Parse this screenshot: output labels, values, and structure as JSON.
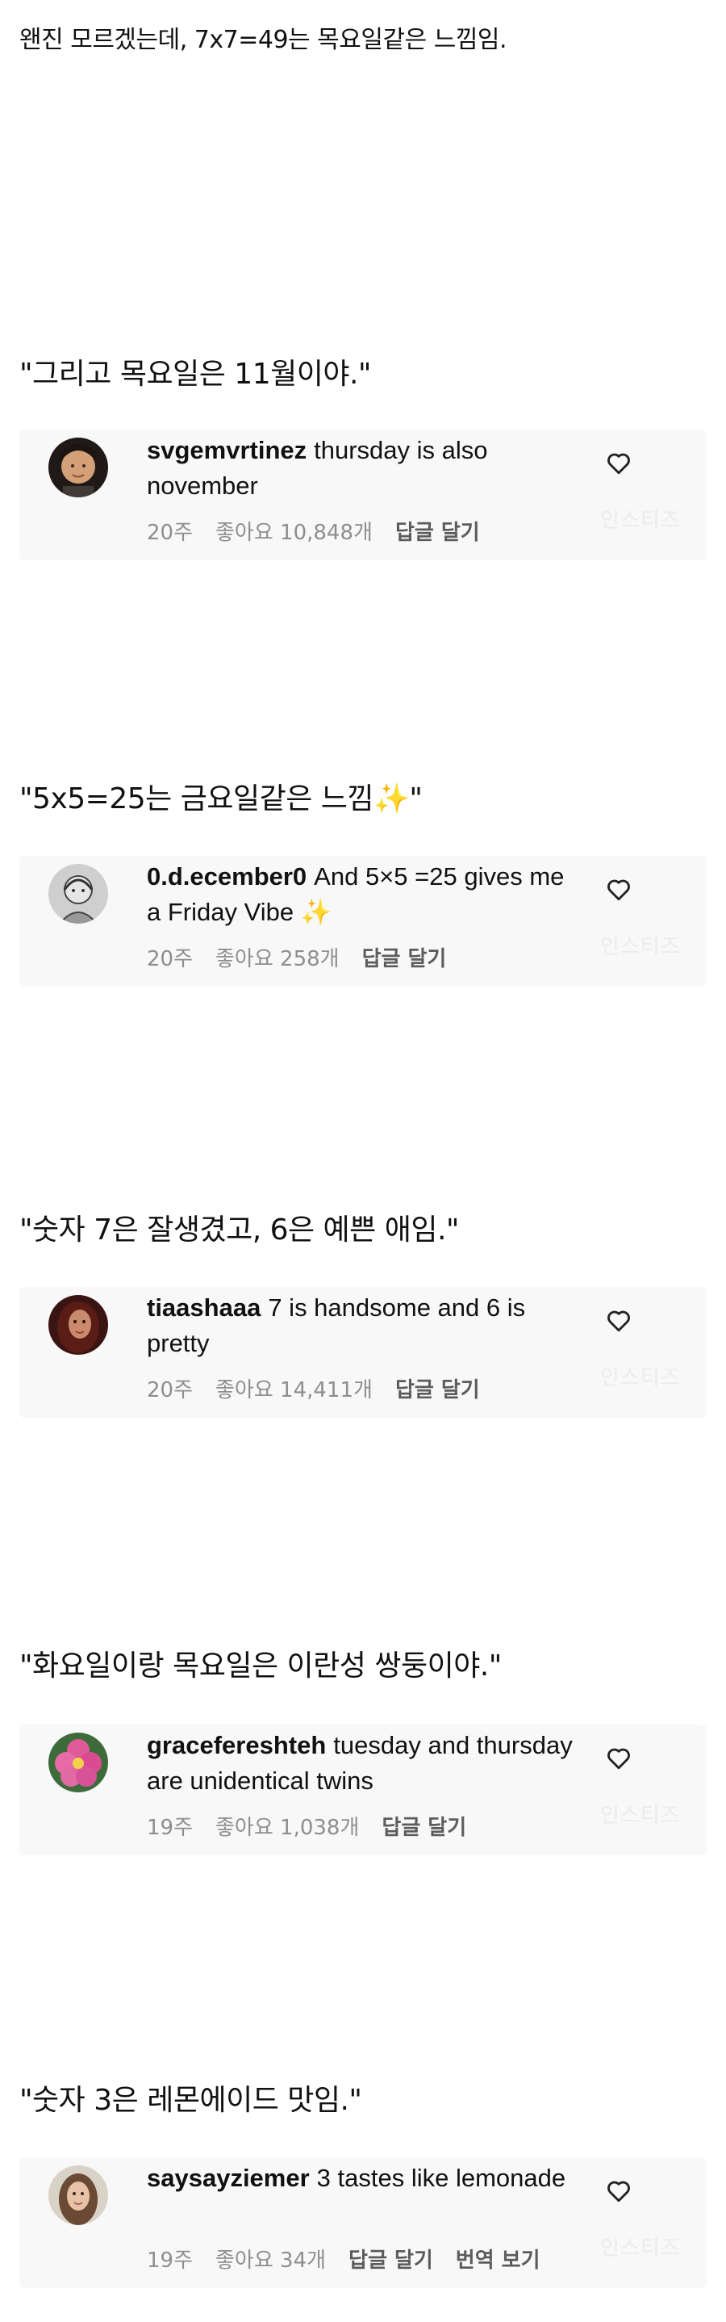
{
  "intro": "왠진 모르겠는데, 7x7=49는 목요일같은 느낌임.",
  "sections": [
    {
      "quote": "\"그리고 목요일은 11월이야.\"",
      "comment": {
        "username": "svgemvrtinez",
        "text": "thursday is also november",
        "age": "20주",
        "likes": "좋아요 10,848개",
        "reply": "답글 달기",
        "watermark": "인스티즈",
        "avatar": "avatar-woman-icon"
      }
    },
    {
      "quote": "\"5x5=25는 금요일같은 느낌✨\"",
      "comment": {
        "username": "0.d.ecember0",
        "text": "And 5×5 =25 gives me a Friday Vibe ✨",
        "age": "20주",
        "likes": "좋아요 258개",
        "reply": "답글 달기",
        "watermark": "인스티즈",
        "avatar": "avatar-sketch-icon"
      }
    },
    {
      "quote": "\"숫자 7은 잘생겼고, 6은 예쁜 애임.\"",
      "comment": {
        "username": "tiaashaaa",
        "text": "7 is handsome and 6 is pretty",
        "age": "20주",
        "likes": "좋아요 14,411개",
        "reply": "답글 달기",
        "watermark": "인스티즈",
        "avatar": "avatar-portrait-icon"
      }
    },
    {
      "quote": "\"화요일이랑 목요일은 이란성 쌍둥이야.\"",
      "comment": {
        "username": "graceferesh​teh",
        "text": "tuesday and thursday are unidentical twins",
        "age": "19주",
        "likes": "좋아요 1,038개",
        "reply": "답글 달기",
        "watermark": "인스티즈",
        "avatar": "avatar-flower-icon"
      }
    },
    {
      "quote": "\"숫자 3은 레몬에이드 맛임.\"",
      "comment": {
        "username": "saysayziemer",
        "text": "3 tastes like lemonade",
        "age": "19주",
        "likes": "좋아요 34개",
        "reply": "답글 달기",
        "translate": "번역 보기",
        "watermark": "인스티즈",
        "avatar": "avatar-selfie-icon"
      }
    }
  ],
  "colors": {
    "text": "#111111",
    "meta": "#8e8e8e",
    "card_bg": "#f8f8f8"
  }
}
